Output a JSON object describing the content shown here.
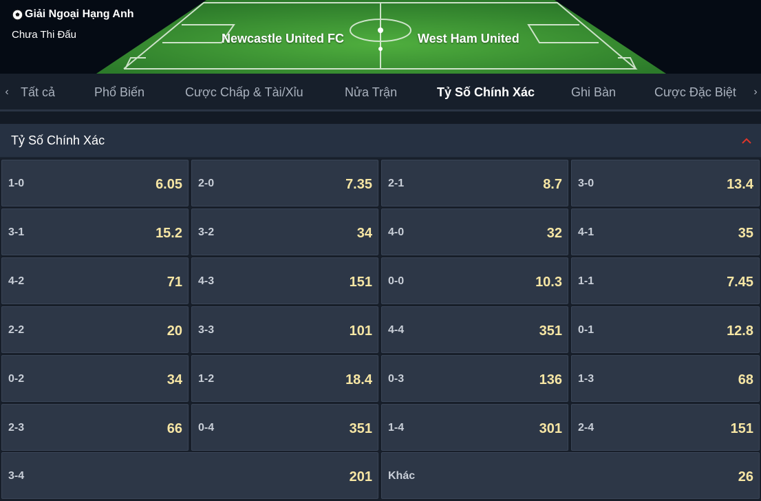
{
  "match": {
    "league": "Giải Ngoại Hạng Anh",
    "status": "Chưa Thi Đấu",
    "home_team": "Newcastle United FC",
    "away_team": "West Ham United"
  },
  "tabs": [
    {
      "label": "Tất cả",
      "active": false
    },
    {
      "label": "Phổ Biến",
      "active": false
    },
    {
      "label": "Cược Chấp & Tài/Xỉu",
      "active": false
    },
    {
      "label": "Nửa Trận",
      "active": false
    },
    {
      "label": "Tỷ Số Chính Xác",
      "active": true
    },
    {
      "label": "Ghi Bàn",
      "active": false
    },
    {
      "label": "Cược Đặc Biệt",
      "active": false
    }
  ],
  "nav": {
    "prev": "‹",
    "next": "›"
  },
  "section": {
    "title": "Tỷ Số Chính Xác"
  },
  "scores": [
    {
      "score": "1-0",
      "odds": "6.05"
    },
    {
      "score": "2-0",
      "odds": "7.35"
    },
    {
      "score": "2-1",
      "odds": "8.7"
    },
    {
      "score": "3-0",
      "odds": "13.4"
    },
    {
      "score": "3-1",
      "odds": "15.2"
    },
    {
      "score": "3-2",
      "odds": "34"
    },
    {
      "score": "4-0",
      "odds": "32"
    },
    {
      "score": "4-1",
      "odds": "35"
    },
    {
      "score": "4-2",
      "odds": "71"
    },
    {
      "score": "4-3",
      "odds": "151"
    },
    {
      "score": "0-0",
      "odds": "10.3"
    },
    {
      "score": "1-1",
      "odds": "7.45"
    },
    {
      "score": "2-2",
      "odds": "20"
    },
    {
      "score": "3-3",
      "odds": "101"
    },
    {
      "score": "4-4",
      "odds": "351"
    },
    {
      "score": "0-1",
      "odds": "12.8"
    },
    {
      "score": "0-2",
      "odds": "34"
    },
    {
      "score": "1-2",
      "odds": "18.4"
    },
    {
      "score": "0-3",
      "odds": "136"
    },
    {
      "score": "1-3",
      "odds": "68"
    },
    {
      "score": "2-3",
      "odds": "66"
    },
    {
      "score": "0-4",
      "odds": "351"
    },
    {
      "score": "1-4",
      "odds": "301"
    },
    {
      "score": "2-4",
      "odds": "151"
    },
    {
      "score": "3-4",
      "odds": "201"
    },
    {
      "score": "Khác",
      "odds": "26"
    }
  ],
  "colors": {
    "accent": "#e0362a",
    "odds": "#f7e6a4",
    "pitch": "#3f9a3a"
  },
  "icons": {
    "league": "soccer-ball-icon",
    "collapse": "chevron-up-icon"
  }
}
